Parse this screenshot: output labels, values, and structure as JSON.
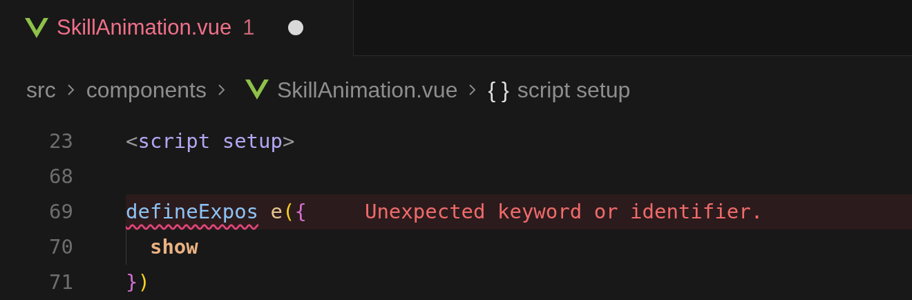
{
  "tab": {
    "name": "SkillAnimation.vue",
    "problems": "1",
    "modified": true,
    "selected": true
  },
  "breadcrumbs": [
    {
      "kind": "folder",
      "label": "src"
    },
    {
      "kind": "folder",
      "label": "components"
    },
    {
      "kind": "vue-file",
      "label": "SkillAnimation.vue"
    },
    {
      "kind": "symbol",
      "icon": "{ }",
      "label": "script setup"
    }
  ],
  "lines": [
    {
      "number": "23",
      "tokens": [
        {
          "kind": "bracket",
          "text": "<",
          "squiggle": false
        },
        {
          "kind": "tag",
          "text": "script setup",
          "squiggle": false
        },
        {
          "kind": "bracket",
          "text": ">",
          "squiggle": false
        }
      ]
    },
    {
      "number": "68"
    },
    {
      "number": "69",
      "error": "Unexpected keyword or identifier.",
      "tokens": [
        {
          "kind": "function",
          "text": "defineExpos",
          "squiggle": true
        },
        {
          "kind": "identifier",
          "text": " e",
          "squiggle": false
        },
        {
          "kind": "paren",
          "text": "(",
          "squiggle": false
        },
        {
          "kind": "brace",
          "text": "{",
          "squiggle": false
        }
      ]
    },
    {
      "number": "70",
      "tokens": [
        {
          "kind": "property",
          "text": "  show",
          "squiggle": false
        }
      ]
    },
    {
      "number": "71",
      "tokens": [
        {
          "kind": "brace",
          "text": "}",
          "squiggle": false
        },
        {
          "kind": "paren",
          "text": ")",
          "squiggle": false
        }
      ]
    }
  ]
}
